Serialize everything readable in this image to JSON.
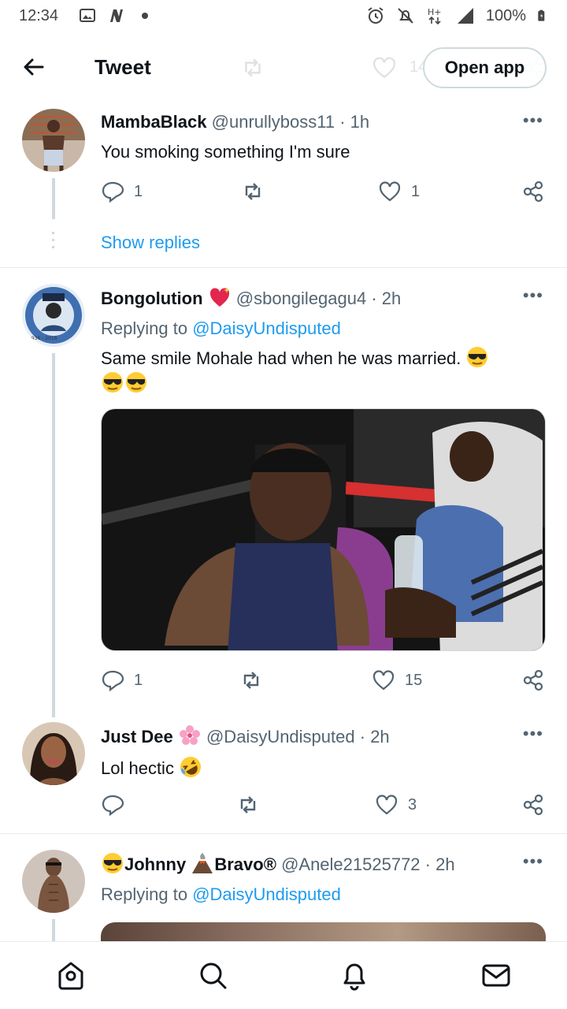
{
  "status_bar": {
    "time": "12:34",
    "battery": "100%",
    "network": "H+"
  },
  "header": {
    "title": "Tweet",
    "open_app": "Open app",
    "ghost_count": "14"
  },
  "tweets": [
    {
      "name": "MambaBlack",
      "handle": "@unrullyboss11",
      "time": "· 1h",
      "text": "You smoking something I'm sure",
      "replies": "1",
      "retweets": "",
      "likes": "1"
    },
    {
      "name": "Bongolution",
      "handle": "@sbongilegagu4",
      "time": "· 2h",
      "replying_prefix": "Replying to",
      "replying_to": "@DaisyUndisputed",
      "text": "Same smile Mohale had when he was married.",
      "avatar_caption": "1936 - 2018",
      "replies": "1",
      "retweets": "",
      "likes": "15"
    },
    {
      "name": "Just Dee",
      "handle": "@DaisyUndisputed",
      "time": "· 2h",
      "text": "Lol hectic",
      "replies": "",
      "retweets": "",
      "likes": "3"
    },
    {
      "name_part1": "Johnny",
      "name_part2": "Bravo®",
      "handle": "@Anele21525772",
      "time": "· 2h",
      "replying_prefix": "Replying to",
      "replying_to": "@DaisyUndisputed"
    }
  ],
  "show_replies": "Show replies",
  "icons": {
    "back": "back-arrow-icon",
    "reply": "reply-icon",
    "retweet": "retweet-icon",
    "like": "heart-icon",
    "share": "share-icon",
    "more": "more-dots-icon",
    "nav": [
      "home-icon",
      "search-icon",
      "notifications-icon",
      "messages-icon"
    ]
  },
  "colors": {
    "accent": "#1d9bf0",
    "secondary_text": "#536471",
    "divider": "#e6ecf0"
  }
}
